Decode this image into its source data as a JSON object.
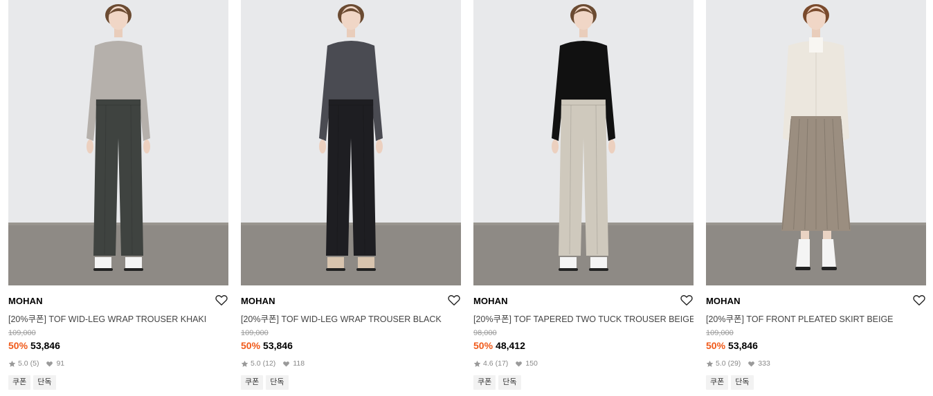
{
  "products": [
    {
      "brand": "MOHAN",
      "name": "[20%쿠폰] TOF WID-LEG WRAP TROUSER KHAKI",
      "original_price": "109,000",
      "discount": "50%",
      "sale_price": "53,846",
      "rating": "5.0",
      "review_count": "(5)",
      "likes": "91",
      "tags": [
        "쿠폰",
        "단독"
      ],
      "image": {
        "top_color": "#b5b0ab",
        "bottom_color": "#3f4340",
        "shoe_color": "#f4f4f4",
        "hair_color": "#6b4b32",
        "style": "trouser"
      }
    },
    {
      "brand": "MOHAN",
      "name": "[20%쿠폰] TOF WID-LEG WRAP TROUSER BLACK",
      "original_price": "109,000",
      "discount": "50%",
      "sale_price": "53,846",
      "rating": "5.0",
      "review_count": "(12)",
      "likes": "118",
      "tags": [
        "쿠폰",
        "단독"
      ],
      "image": {
        "top_color": "#4a4b52",
        "bottom_color": "#1e1e22",
        "shoe_color": "#d8c4ae",
        "hair_color": "#6b4b32",
        "style": "trouser"
      }
    },
    {
      "brand": "MOHAN",
      "name": "[20%쿠폰] TOF TAPERED TWO TUCK TROUSER BEIGE",
      "original_price": "98,000",
      "discount": "50%",
      "sale_price": "48,412",
      "rating": "4.6",
      "review_count": "(17)",
      "likes": "150",
      "tags": [
        "쿠폰",
        "단독"
      ],
      "image": {
        "top_color": "#111111",
        "bottom_color": "#cfc9bd",
        "shoe_color": "#f4f4f4",
        "hair_color": "#6b4b32",
        "style": "trouser"
      }
    },
    {
      "brand": "MOHAN",
      "name": "[20%쿠폰] TOF FRONT PLEATED SKIRT BEIGE",
      "original_price": "109,000",
      "discount": "50%",
      "sale_price": "53,846",
      "rating": "5.0",
      "review_count": "(29)",
      "likes": "333",
      "tags": [
        "쿠폰",
        "단독"
      ],
      "image": {
        "top_color": "#ece7de",
        "bottom_color": "#9b8e80",
        "shoe_color": "#f4f4f4",
        "hair_color": "#7a4a2c",
        "style": "skirt"
      }
    }
  ],
  "colors": {
    "discount": "#f05a1a",
    "wall": "#e8e9eb",
    "floor": "#8e8a85"
  },
  "icons": {
    "wishlist": "heart-outline-icon",
    "rating": "star-icon",
    "likes": "heart-icon"
  }
}
